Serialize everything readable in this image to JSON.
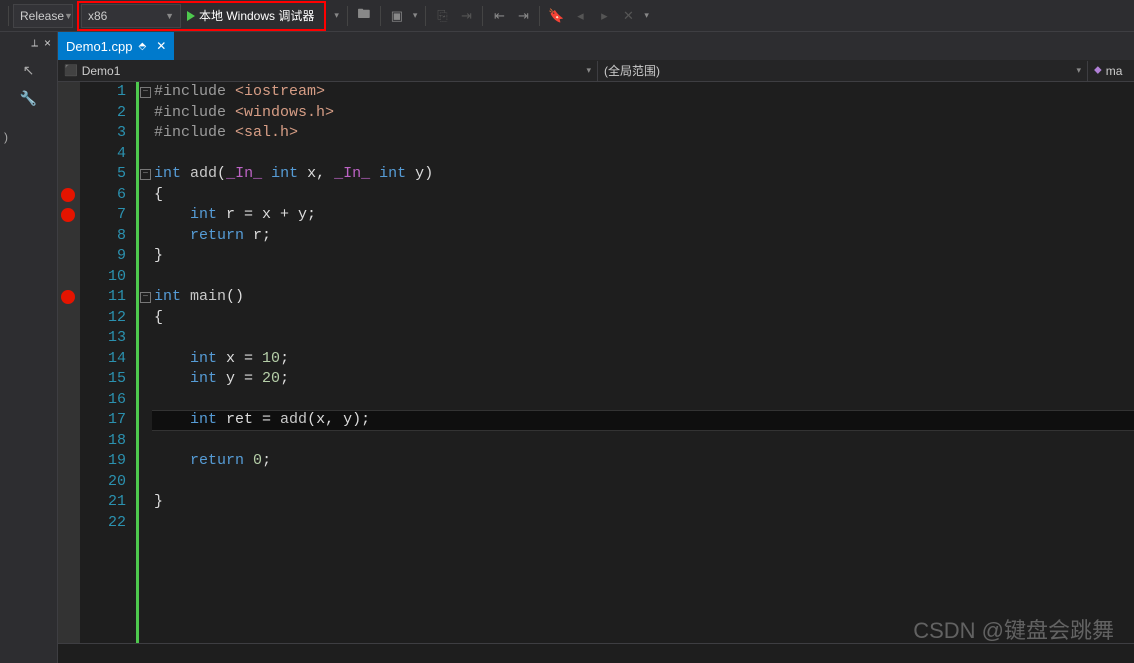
{
  "toolbar": {
    "solutionConfig": "Release",
    "platform": "x86",
    "debuggerLabel": "本地 Windows 调试器"
  },
  "sidebar": {
    "pinLabel": "📌",
    "closeLabel": "×",
    "searchPlaceholder": ")"
  },
  "tab": {
    "filename": "Demo1.cpp",
    "pinned": "📌",
    "close": "✕"
  },
  "navbar": {
    "project": "Demo1",
    "scope": "(全局范围)",
    "member": "ma"
  },
  "editor": {
    "lineCount": 22,
    "breakpoints": [
      6,
      7,
      11
    ],
    "foldLines": [
      1,
      5,
      11
    ],
    "currentLine": 17,
    "code": [
      {
        "n": 1,
        "t": [
          {
            "c": "pp",
            "s": "#include "
          },
          {
            "c": "str",
            "s": "<iostream>"
          }
        ]
      },
      {
        "n": 2,
        "t": [
          {
            "c": "pp",
            "s": "#include "
          },
          {
            "c": "str",
            "s": "<windows.h>"
          }
        ]
      },
      {
        "n": 3,
        "t": [
          {
            "c": "pp",
            "s": "#include "
          },
          {
            "c": "str",
            "s": "<sal.h>"
          }
        ]
      },
      {
        "n": 4,
        "t": []
      },
      {
        "n": 5,
        "t": [
          {
            "c": "kw",
            "s": "int"
          },
          {
            "c": "plain",
            "s": " "
          },
          {
            "c": "fn",
            "s": "add"
          },
          {
            "c": "paren",
            "s": "("
          },
          {
            "c": "macro",
            "s": "_In_"
          },
          {
            "c": "plain",
            "s": " "
          },
          {
            "c": "kw",
            "s": "int"
          },
          {
            "c": "plain",
            "s": " x, "
          },
          {
            "c": "macro",
            "s": "_In_"
          },
          {
            "c": "plain",
            "s": " "
          },
          {
            "c": "kw",
            "s": "int"
          },
          {
            "c": "plain",
            "s": " y"
          },
          {
            "c": "paren",
            "s": ")"
          }
        ]
      },
      {
        "n": 6,
        "t": [
          {
            "c": "plain",
            "s": "{"
          }
        ]
      },
      {
        "n": 7,
        "t": [
          {
            "c": "plain",
            "s": "    "
          },
          {
            "c": "kw",
            "s": "int"
          },
          {
            "c": "plain",
            "s": " r = x + y;"
          }
        ]
      },
      {
        "n": 8,
        "t": [
          {
            "c": "plain",
            "s": "    "
          },
          {
            "c": "kw",
            "s": "return"
          },
          {
            "c": "plain",
            "s": " r;"
          }
        ]
      },
      {
        "n": 9,
        "t": [
          {
            "c": "plain",
            "s": "}"
          }
        ]
      },
      {
        "n": 10,
        "t": []
      },
      {
        "n": 11,
        "t": [
          {
            "c": "kw",
            "s": "int"
          },
          {
            "c": "plain",
            "s": " "
          },
          {
            "c": "fn",
            "s": "main"
          },
          {
            "c": "paren",
            "s": "()"
          }
        ]
      },
      {
        "n": 12,
        "t": [
          {
            "c": "plain",
            "s": "{"
          }
        ]
      },
      {
        "n": 13,
        "t": []
      },
      {
        "n": 14,
        "t": [
          {
            "c": "plain",
            "s": "    "
          },
          {
            "c": "kw",
            "s": "int"
          },
          {
            "c": "plain",
            "s": " x = "
          },
          {
            "c": "num",
            "s": "10"
          },
          {
            "c": "plain",
            "s": ";"
          }
        ]
      },
      {
        "n": 15,
        "t": [
          {
            "c": "plain",
            "s": "    "
          },
          {
            "c": "kw",
            "s": "int"
          },
          {
            "c": "plain",
            "s": " y = "
          },
          {
            "c": "num",
            "s": "20"
          },
          {
            "c": "plain",
            "s": ";"
          }
        ]
      },
      {
        "n": 16,
        "t": []
      },
      {
        "n": 17,
        "t": [
          {
            "c": "plain",
            "s": "    "
          },
          {
            "c": "kw",
            "s": "int"
          },
          {
            "c": "plain",
            "s": " ret = "
          },
          {
            "c": "fn",
            "s": "add"
          },
          {
            "c": "paren",
            "s": "("
          },
          {
            "c": "plain",
            "s": "x, y"
          },
          {
            "c": "paren",
            "s": ")"
          },
          {
            "c": "plain",
            "s": ";"
          }
        ]
      },
      {
        "n": 18,
        "t": []
      },
      {
        "n": 19,
        "t": [
          {
            "c": "plain",
            "s": "    "
          },
          {
            "c": "kw",
            "s": "return"
          },
          {
            "c": "plain",
            "s": " "
          },
          {
            "c": "num",
            "s": "0"
          },
          {
            "c": "plain",
            "s": ";"
          }
        ]
      },
      {
        "n": 20,
        "t": []
      },
      {
        "n": 21,
        "t": [
          {
            "c": "plain",
            "s": "}"
          }
        ]
      },
      {
        "n": 22,
        "t": []
      }
    ]
  },
  "watermark": "CSDN @键盘会跳舞"
}
